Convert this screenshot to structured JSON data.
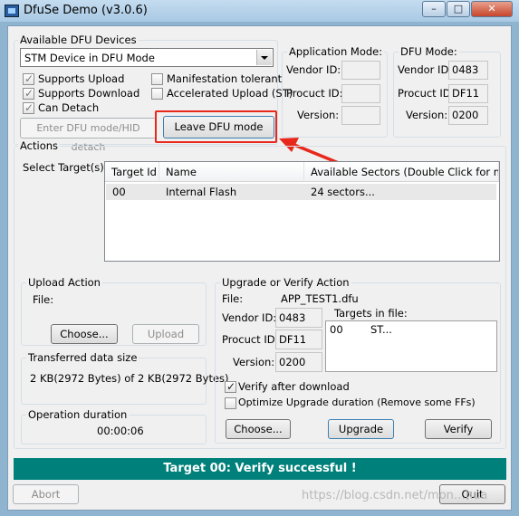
{
  "window": {
    "title": "DfuSe Demo (v3.0.6)",
    "min": "–",
    "max": "□",
    "close": "✕"
  },
  "devices": {
    "group_title": "Available DFU Devices",
    "selected": "STM Device in DFU Mode"
  },
  "caps": {
    "upload": "Supports Upload",
    "download": "Supports Download",
    "detach": "Can Detach",
    "manifest": "Manifestation tolerant",
    "accel": "Accelerated Upload (ST)"
  },
  "buttons": {
    "enter_dfu": "Enter DFU mode/HID detach",
    "leave_dfu": "Leave DFU mode",
    "choose_upload": "Choose...",
    "upload": "Upload",
    "choose_upgrade": "Choose...",
    "upgrade": "Upgrade",
    "verify": "Verify",
    "abort": "Abort",
    "quit": "Quit"
  },
  "app_mode": {
    "title": "Application Mode:",
    "vendor_label": "Vendor ID:",
    "product_label": "Procuct ID:",
    "version_label": "Version:",
    "vendor": "",
    "product": "",
    "version": ""
  },
  "dfu_mode": {
    "title": "DFU Mode:",
    "vendor_label": "Vendor ID:",
    "product_label": "Procuct ID:",
    "version_label": "Version:",
    "vendor": "0483",
    "product": "DF11",
    "version": "0200"
  },
  "actions": {
    "title": "Actions",
    "select_target": "Select Target(s):",
    "columns": [
      "Target Id",
      "Name",
      "Available Sectors (Double Click for more)"
    ],
    "rows": [
      {
        "id": "00",
        "name": "Internal Flash",
        "sectors": "24 sectors..."
      }
    ]
  },
  "upload": {
    "title": "Upload Action",
    "file_label": "File:"
  },
  "transfer": {
    "title": "Transferred data size",
    "value": "2 KB(2972 Bytes) of 2 KB(2972 Bytes)"
  },
  "duration": {
    "title": "Operation duration",
    "value": "00:00:06"
  },
  "upgrade": {
    "title": "Upgrade or Verify Action",
    "file_label": "File:",
    "file": "APP_TEST1.dfu",
    "vendor_label": "Vendor ID:",
    "vendor": "0483",
    "product_label": "Procuct ID:",
    "product": "DF11",
    "version_label": "Version:",
    "version": "0200",
    "targets_label": "Targets in file:",
    "target_id": "00",
    "target_name": "ST...",
    "verify_after": "Verify after download",
    "optimize": "Optimize Upgrade duration (Remove some FFs)"
  },
  "status": "Target 00: Verify successful !",
  "watermark": "https://blog.csdn.net/mon…hua",
  "colors": {
    "status_bg": "#00807a",
    "highlight": "#e8281b",
    "selection": "#e8e8e8"
  }
}
